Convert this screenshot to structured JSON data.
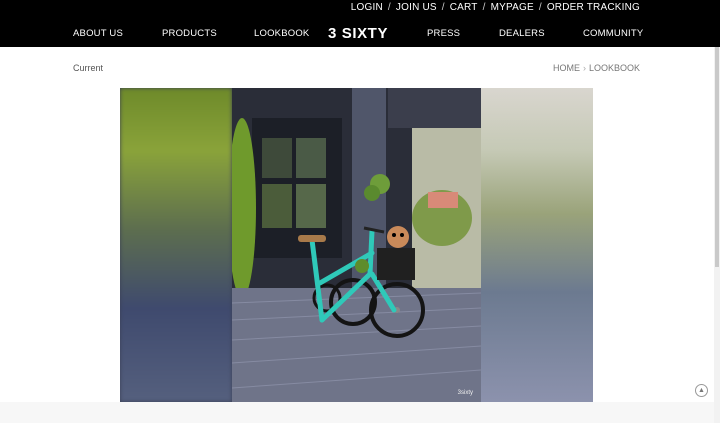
{
  "header": {
    "util_links": [
      "LOGIN",
      "JOIN US",
      "CART",
      "MYPAGE",
      "ORDER TRACKING"
    ],
    "util_sep": "/",
    "nav": {
      "about": "ABOUT US",
      "products": "PRODUCTS",
      "lookbook": "LOOKBOOK",
      "press": "PRESS",
      "dealers": "DEALERS",
      "community": "COMMUNITY"
    },
    "logo": "3 SIXTY"
  },
  "breadcrumb": {
    "current_label": "Current",
    "home": "HOME",
    "sep": "›",
    "page": "LOOKBOOK"
  },
  "photo": {
    "watermark": "3sixty"
  },
  "controls": {
    "scroll_top_icon": "up-arrow-icon"
  },
  "colors": {
    "header_bg": "#000000",
    "page_bg": "#ffffff",
    "bike_teal": "#2fc9b9"
  }
}
